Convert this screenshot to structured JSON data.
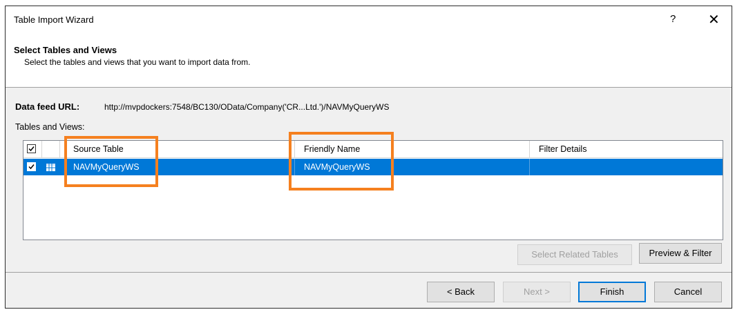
{
  "window": {
    "title": "Table Import Wizard",
    "help_glyph": "?",
    "close_glyph": "✕"
  },
  "header": {
    "title": "Select Tables and Views",
    "subtitle": "Select the tables and views that you want to import data from."
  },
  "feed": {
    "label": "Data feed URL:",
    "url": "http://mvpdockers:7548/BC130/OData/Company('CR...Ltd.')/NAVMyQueryWS"
  },
  "tables_label": "Tables and Views:",
  "grid": {
    "columns": [
      "Source Table",
      "Friendly Name",
      "Filter Details"
    ],
    "rows": [
      {
        "checked": true,
        "source_table": "NAVMyQueryWS",
        "friendly_name": "NAVMyQueryWS",
        "filter_details": ""
      }
    ]
  },
  "buttons": {
    "select_related": "Select Related Tables",
    "preview_filter": "Preview & Filter",
    "back": "< Back",
    "next": "Next >",
    "finish": "Finish",
    "cancel": "Cancel"
  },
  "colors": {
    "selection": "#0078d7",
    "highlight": "#f5801f"
  }
}
